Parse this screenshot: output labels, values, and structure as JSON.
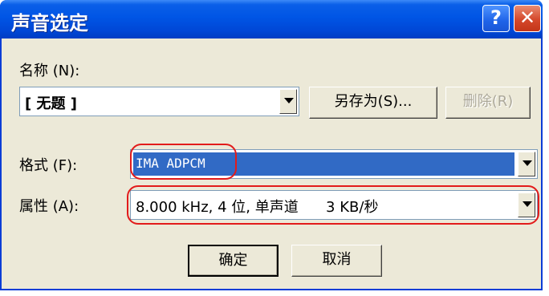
{
  "window": {
    "title": "声音选定"
  },
  "titlebar": {
    "help_label": "?",
    "close_label": "✕"
  },
  "name_field": {
    "label": "名称 (N):",
    "value": "[ 无题 ]"
  },
  "buttons": {
    "save_as": "另存为(S)...",
    "delete": "删除(R)",
    "ok": "确定",
    "cancel": "取消"
  },
  "format_field": {
    "label": "格式 (F):",
    "value": "IMA ADPCM"
  },
  "attributes_field": {
    "label": "属性 (A):",
    "value": "8.000 kHz, 4 位, 单声道      3 KB/秒"
  },
  "colors": {
    "title_blue": "#0055e5",
    "selection_blue": "#316ac5",
    "highlight_red": "#e21b1b",
    "dialog_bg": "#ece9d8"
  }
}
